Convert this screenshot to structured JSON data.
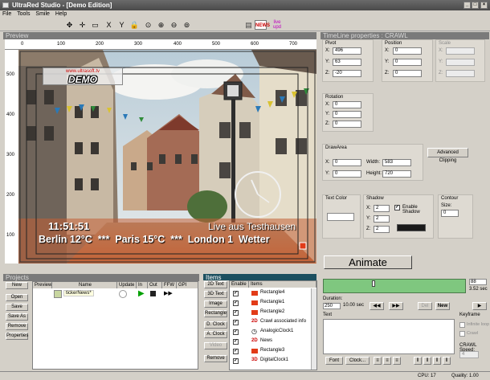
{
  "window": {
    "title": "UltraRed Studio - [Demo Edition]"
  },
  "menu": [
    "File",
    "Tools",
    "Smile",
    "Help"
  ],
  "toolbar": {
    "live_label": "live\nupd"
  },
  "preview": {
    "header": "Preview",
    "ruler_top": [
      "0",
      "100",
      "200",
      "300",
      "400",
      "500",
      "600",
      "700"
    ],
    "ruler_left": [
      "500",
      "400",
      "300",
      "200",
      "100"
    ],
    "logo_top": "www.ultrasoft.tv",
    "logo_main": "DEMO",
    "clock_text": "11:51:51",
    "live_text": "Live aus Testhausen",
    "crawl_text": "Berlin 12°C  ***  Paris 15°C  ***  London 1  Wetter"
  },
  "timeline": {
    "header": "TimeLine properties : CRAWL",
    "pivot": {
      "label": "Pivot",
      "x": "496",
      "y": "63",
      "z": "-20"
    },
    "position": {
      "label": "Position",
      "x": "0",
      "y": "0",
      "z": "0"
    },
    "scale": {
      "label": "Scale"
    },
    "rotation": {
      "label": "Rotation",
      "x": "0",
      "y": "0",
      "z": "0"
    },
    "drawarea": {
      "label": "DrawArea",
      "x": "0",
      "y": "0",
      "width": "583",
      "height": "720"
    },
    "axis_x": "X:",
    "axis_y": "Y:",
    "axis_z": "Z:",
    "width_label": "Width:",
    "height_label": "Height:",
    "advanced_clipping": "Advanced Clipping",
    "text_color": "Text Color",
    "shadow": {
      "label": "Shadow",
      "x": "2",
      "y": "2",
      "z": "2",
      "enable": "Enable Shadow"
    },
    "contour": {
      "label": "Contour",
      "size_label": "Size:",
      "size": "0"
    },
    "animate": "Animate"
  },
  "colors": {
    "text_color": "#ffffff",
    "shadow_color": "#1a1a1a",
    "timeline_bar": "#7fc77f",
    "items_header": "#1c5060"
  },
  "bottom_right": {
    "timeline_value": "88",
    "timeline_sec": "3.52 sec",
    "duration_label": "Duration:",
    "duration_value": "250",
    "duration_sec": "10.00 sec",
    "del_label": "Del",
    "new_label": "New",
    "text_label": "Text",
    "font_button": "Font",
    "clock_button": "Clock...",
    "keyframe_label": "Keyframe",
    "infinite_loop": "Infinite loop",
    "crawl_option": "Crawl",
    "crawl_speed_label": "CRAWL Speed:",
    "crawl_speed_value": "4"
  },
  "projects": {
    "header": "Projects",
    "buttons": [
      "New",
      "Open",
      "Save",
      "Save As",
      "Remove",
      "Properties"
    ],
    "columns": [
      "Preview",
      "Name",
      "Update",
      "In",
      "Out",
      "FFW",
      "GPI"
    ],
    "row": {
      "name": "tickerNews*"
    }
  },
  "items": {
    "header": "Items",
    "tools": [
      "2D Text",
      "3D Text",
      "Image",
      "Rectangle",
      "D. Clock",
      "A. Clock",
      "Video",
      "Remove"
    ],
    "columns": [
      "Enable",
      "Items"
    ],
    "rows": [
      {
        "icon": "rect",
        "label": "Rectangle4"
      },
      {
        "icon": "rect",
        "label": "Rectangle1"
      },
      {
        "icon": "rect",
        "label": "Rectangle2"
      },
      {
        "icon": "2d",
        "label": "Crawl associated info"
      },
      {
        "icon": "clock",
        "label": "AnalogicClock1"
      },
      {
        "icon": "2d",
        "label": "News"
      },
      {
        "icon": "rect",
        "label": "Rectangle3"
      },
      {
        "icon": "3d",
        "label": "DigitalClock1"
      }
    ]
  },
  "status": {
    "cpu": "CPU: 17",
    "quality": "Quality: 1.00"
  }
}
